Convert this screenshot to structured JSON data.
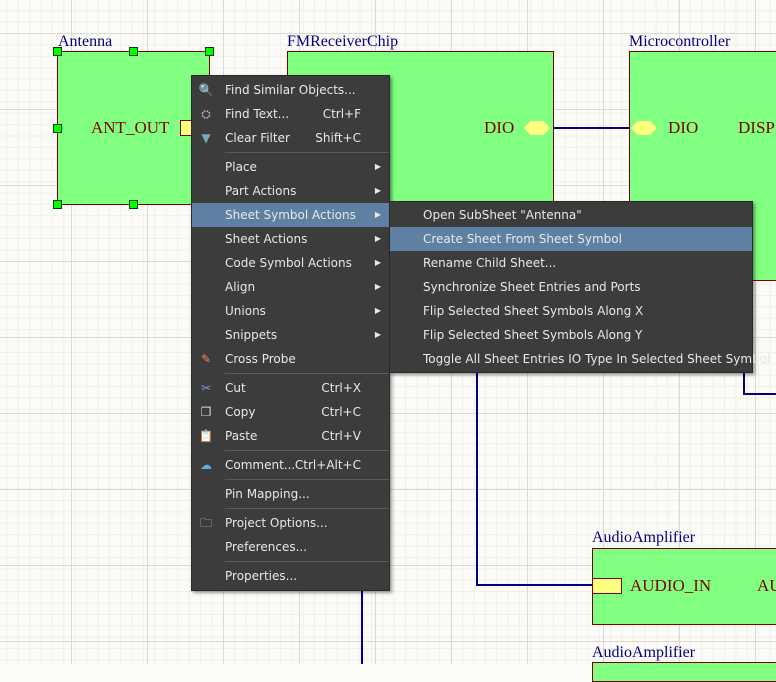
{
  "schematic": {
    "symbols": [
      {
        "label": "Antenna",
        "ports": [
          "ANT_OUT"
        ]
      },
      {
        "label": "FMReceiverChip",
        "ports": [
          "DIO"
        ]
      },
      {
        "label": "Microcontroller",
        "ports": [
          "DIO",
          "DISP"
        ]
      },
      {
        "label": "AudioAmplifier",
        "ports": [
          "AUDIO_IN",
          "AU"
        ]
      },
      {
        "label": "AudioAmplifier"
      }
    ],
    "colors": {
      "sheet_fill": "#80ff80",
      "border": "#800000",
      "wire": "#000080",
      "label": "#000080",
      "entry": "#ffff80"
    }
  },
  "context_menu": {
    "items": [
      {
        "label": "Find Similar Objects...",
        "icon": "magnifier-icon"
      },
      {
        "label": "Find Text...",
        "shortcut": "Ctrl+F",
        "icon": "binoculars-icon"
      },
      {
        "label": "Clear Filter",
        "shortcut": "Shift+C",
        "icon": "clear-filter-icon"
      },
      {
        "label": "Place",
        "submenu": true
      },
      {
        "label": "Part Actions",
        "submenu": true
      },
      {
        "label": "Sheet Symbol Actions",
        "submenu": true,
        "highlighted": true
      },
      {
        "label": "Sheet Actions",
        "submenu": true
      },
      {
        "label": "Code Symbol Actions",
        "submenu": true
      },
      {
        "label": "Align",
        "submenu": true
      },
      {
        "label": "Unions",
        "submenu": true
      },
      {
        "label": "Snippets",
        "submenu": true
      },
      {
        "label": "Cross Probe",
        "icon": "cross-probe-icon"
      },
      {
        "label": "Cut",
        "shortcut": "Ctrl+X",
        "icon": "scissors-icon"
      },
      {
        "label": "Copy",
        "shortcut": "Ctrl+C",
        "icon": "copy-icon"
      },
      {
        "label": "Paste",
        "shortcut": "Ctrl+V",
        "icon": "paste-icon"
      },
      {
        "label": "Comment...",
        "shortcut": "Ctrl+Alt+C",
        "icon": "comment-icon"
      },
      {
        "label": "Pin Mapping..."
      },
      {
        "label": "Project Options...",
        "icon": "project-options-icon"
      },
      {
        "label": "Preferences..."
      },
      {
        "label": "Properties..."
      }
    ],
    "highlight_color": "#5e81a3"
  },
  "submenu": {
    "items": [
      {
        "label": "Open SubSheet \"Antenna\""
      },
      {
        "label": "Create Sheet From Sheet Symbol",
        "highlighted": true
      },
      {
        "label": "Rename Child Sheet..."
      },
      {
        "label": "Synchronize Sheet Entries and Ports"
      },
      {
        "label": "Flip Selected Sheet Symbols Along X"
      },
      {
        "label": "Flip Selected Sheet Symbols Along Y"
      },
      {
        "label": "Toggle All Sheet Entries IO Type In Selected Sheet Symbol"
      }
    ]
  }
}
